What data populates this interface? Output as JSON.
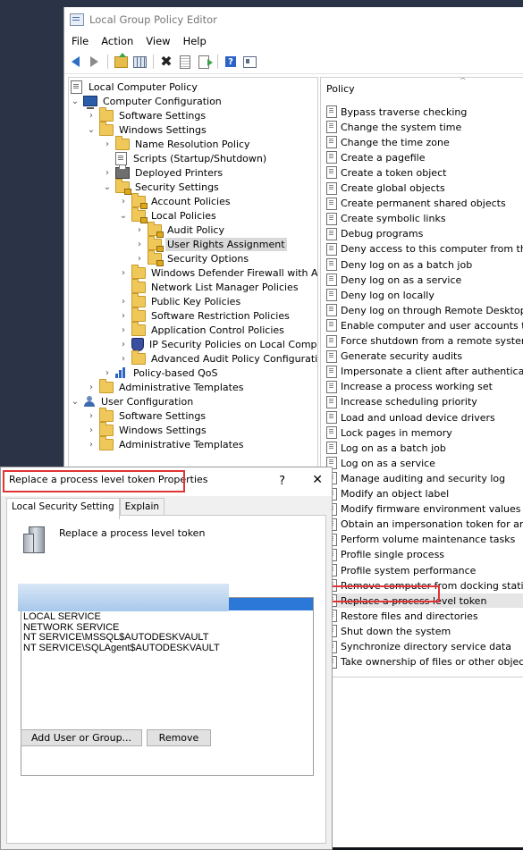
{
  "window": {
    "title": "Local Group Policy Editor"
  },
  "menu": [
    "File",
    "Action",
    "View",
    "Help"
  ],
  "tree": {
    "root": "Local Computer Policy",
    "computer_config": "Computer Configuration",
    "software_settings": "Software Settings",
    "windows_settings": "Windows Settings",
    "name_resolution": "Name Resolution Policy",
    "scripts": "Scripts (Startup/Shutdown)",
    "deployed_printers": "Deployed Printers",
    "security_settings": "Security Settings",
    "account_policies": "Account Policies",
    "local_policies": "Local Policies",
    "audit_policy": "Audit Policy",
    "user_rights": "User Rights Assignment",
    "security_options": "Security Options",
    "defender_firewall": "Windows Defender Firewall with Advanc",
    "network_list": "Network List Manager Policies",
    "public_key": "Public Key Policies",
    "software_restriction": "Software Restriction Policies",
    "app_control": "Application Control Policies",
    "ip_security": "IP Security Policies on Local Computer",
    "advanced_audit": "Advanced Audit Policy Configuration",
    "qos": "Policy-based QoS",
    "admin_templates_1": "Administrative Templates",
    "user_config": "User Configuration",
    "user_software": "Software Settings",
    "user_windows": "Windows Settings",
    "user_admin_templates": "Administrative Templates"
  },
  "policy_pane": {
    "header": "Policy",
    "items": [
      "Bypass traverse checking",
      "Change the system time",
      "Change the time zone",
      "Create a pagefile",
      "Create a token object",
      "Create global objects",
      "Create permanent shared objects",
      "Create symbolic links",
      "Debug programs",
      "Deny access to this computer from the netw",
      "Deny log on as a batch job",
      "Deny log on as a service",
      "Deny log on locally",
      "Deny log on through Remote Desktop Servic",
      "Enable computer and user accounts to be tr",
      "Force shutdown from a remote system",
      "Generate security audits",
      "Impersonate a client after authentication",
      "Increase a process working set",
      "Increase scheduling priority",
      "Load and unload device drivers",
      "Lock pages in memory",
      "Log on as a batch job",
      "Log on as a service",
      "Manage auditing and security log",
      "Modify an object label",
      "Modify firmware environment values",
      "Obtain an impersonation token for another",
      "Perform volume maintenance tasks",
      "Profile single process",
      "Profile system performance",
      "Remove computer from docking station",
      "Replace a process level token",
      "Restore files and directories",
      "Shut down the system",
      "Synchronize directory service data",
      "Take ownership of files or other objects"
    ]
  },
  "dialog": {
    "title": "Replace a process level token Properties",
    "help_glyph": "?",
    "close_glyph": "✕",
    "tabs": [
      "Local Security Setting",
      "Explain"
    ],
    "policy_name": "Replace a process level token",
    "accounts": [
      "LOCAL SERVICE",
      "NETWORK SERVICE",
      "NT SERVICE\\MSSQL$AUTODESKVAULT",
      "NT SERVICE\\SQLAgent$AUTODESKVAULT"
    ],
    "add_button": "Add User or Group...",
    "remove_button": "Remove"
  },
  "colors": {
    "highlight_outline": "#e03535",
    "selection_blue": "#2b78d8",
    "desktop": "#2b3446"
  }
}
